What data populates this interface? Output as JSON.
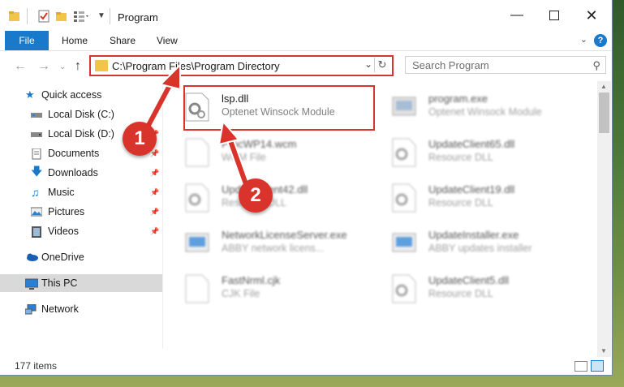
{
  "window": {
    "title": "Program"
  },
  "ribbon": {
    "file": "File",
    "tabs": [
      "Home",
      "Share",
      "View"
    ],
    "help": "?"
  },
  "address": {
    "path": "C:\\Program Files\\Program Directory"
  },
  "search": {
    "placeholder": "Search Program"
  },
  "sidebar": {
    "quick_access": "Quick access",
    "items": [
      {
        "label": "Local Disk (C:)",
        "pinned": false
      },
      {
        "label": "Local Disk (D:)",
        "pinned": true
      },
      {
        "label": "Documents",
        "pinned": true
      },
      {
        "label": "Downloads",
        "pinned": true
      },
      {
        "label": "Music",
        "pinned": true
      },
      {
        "label": "Pictures",
        "pinned": true
      },
      {
        "label": "Videos",
        "pinned": true
      }
    ],
    "onedrive": "OneDrive",
    "thispc": "This PC",
    "network": "Network"
  },
  "files": [
    {
      "name": "lsp.dll",
      "desc": "Optenet Winsock Module"
    },
    {
      "name": "program.exe",
      "desc": "Optenet Winsock Module"
    },
    {
      "name": "ProcWP14.wcm",
      "desc": "WCM File"
    },
    {
      "name": "UpdateClient65.dll",
      "desc": "Resource DLL"
    },
    {
      "name": "UpdateClient42.dll",
      "desc": "Resource DLL"
    },
    {
      "name": "UpdateClient19.dll",
      "desc": "Resource DLL"
    },
    {
      "name": "NetworkLicenseServer.exe",
      "desc": "ABBY network licens..."
    },
    {
      "name": "UpdateInstaller.exe",
      "desc": "ABBY updates installer"
    },
    {
      "name": "FastNrml.cjk",
      "desc": "CJK File"
    },
    {
      "name": "UpdateClient5.dll",
      "desc": "Resource DLL"
    }
  ],
  "status": {
    "count": "177 items"
  },
  "annotations": {
    "step1": "1",
    "step2": "2"
  },
  "colors": {
    "accent": "#1979ca",
    "highlight": "#d9342b",
    "folder": "#f3c44a"
  }
}
